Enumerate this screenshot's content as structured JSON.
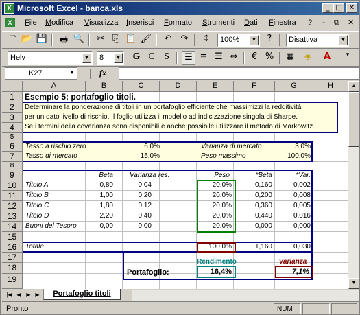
{
  "window": {
    "title": "Microsoft Excel - banca.xls",
    "app_icon": "X"
  },
  "menu": [
    "File",
    "Modifica",
    "Visualizza",
    "Inserisci",
    "Formato",
    "Strumenti",
    "Dati",
    "Finestra",
    "?"
  ],
  "toolbar": {
    "zoom": "100%",
    "style": "Disattiva",
    "font": "Helv",
    "font_size": "8",
    "bold": "G",
    "italic": "C",
    "underline": "S"
  },
  "formula_bar": {
    "name_box": "K27",
    "fx": "fx",
    "content": ""
  },
  "columns": [
    "A",
    "B",
    "C",
    "D",
    "E",
    "F",
    "G",
    "H"
  ],
  "rows": [
    "1",
    "2",
    "3",
    "4",
    "5",
    "6",
    "7",
    "8",
    "9",
    "10",
    "11",
    "12",
    "13",
    "14",
    "15",
    "16",
    "17",
    "18",
    "19"
  ],
  "sheet": {
    "title": "Esempio 5: portafoglio titoli.",
    "desc": [
      "Determinare la ponderazione di titoli in un portafoglio efficiente che massimizzi la redditività",
      "per un dato livello di rischio. Il foglio utilizza il modello ad indicizzazione singola di Sharpe.",
      "Se i termini della covarianza sono disponibili è anche possibile utilizzare il metodo di Markowitz."
    ],
    "params": {
      "risk_free_label": "Tasso a rischio zero",
      "risk_free": "6,0%",
      "market_rate_label": "Tasso di mercato",
      "market_rate": "15,0%",
      "market_var_label": "Varianza di mercato",
      "market_var": "3,0%",
      "max_weight_label": "Peso massimo",
      "max_weight": "100,0%"
    },
    "headers": {
      "beta": "Beta",
      "res_var": "Varianza res.",
      "weight": "Peso",
      "beta_w": "*Beta",
      "var_w": "*Var."
    },
    "securities": [
      {
        "name": "Titolo A",
        "beta": "0,80",
        "res_var": "0,04",
        "weight": "20,0%",
        "beta_w": "0,160",
        "var_w": "0,002"
      },
      {
        "name": "Titolo B",
        "beta": "1,00",
        "res_var": "0,20",
        "weight": "20,0%",
        "beta_w": "0,200",
        "var_w": "0,008"
      },
      {
        "name": "Titolo C",
        "beta": "1,80",
        "res_var": "0,12",
        "weight": "20,0%",
        "beta_w": "0,360",
        "var_w": "0,005"
      },
      {
        "name": "Titolo D",
        "beta": "2,20",
        "res_var": "0,40",
        "weight": "20,0%",
        "beta_w": "0,440",
        "var_w": "0,016"
      },
      {
        "name": "Buoni del Tesoro",
        "beta": "0,00",
        "res_var": "0,00",
        "weight": "20,0%",
        "beta_w": "0,000",
        "var_w": "0,000"
      }
    ],
    "total": {
      "label": "Totale",
      "weight": "100,0%",
      "beta_w": "1,160",
      "var_w": "0,030"
    },
    "portfolio": {
      "label": "Portafoglio:",
      "return_label": "Rendimento",
      "return": "16,4%",
      "var_label": "Varianza",
      "var": "7,1%"
    }
  },
  "sheet_tab": "Portafoglio titoli",
  "status": {
    "text": "Pronto",
    "num": "NUM"
  },
  "colors": {
    "title_bar": "#0a246a",
    "desc_fill": "#ffffe0",
    "frame_blue": "#000080",
    "weight_green": "#008000",
    "total_red": "#800000",
    "return_teal": "#008080"
  }
}
